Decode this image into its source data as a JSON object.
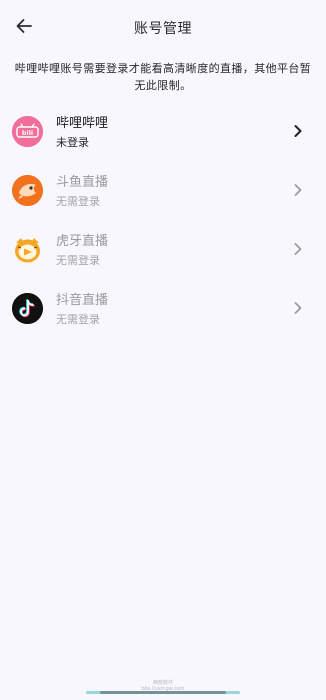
{
  "app_bar": {
    "title": "账号管理",
    "back_icon": "arrow-left-icon"
  },
  "notice": {
    "text": "哔哩哔哩账号需要登录才能看高清晰度的直播，其他平台暂无此限制。"
  },
  "accounts": [
    {
      "name": "哔哩哔哩",
      "status": "未登录",
      "icon": "bilibili-logo-icon",
      "enabled": true,
      "brand_color": "#f06e99"
    },
    {
      "name": "斗鱼直播",
      "status": "无需登录",
      "icon": "douyu-logo-icon",
      "enabled": false,
      "brand_color": "#f2711c"
    },
    {
      "name": "虎牙直播",
      "status": "无需登录",
      "icon": "huya-logo-icon",
      "enabled": false,
      "brand_color": "#f5a623"
    },
    {
      "name": "抖音直播",
      "status": "无需登录",
      "icon": "douyin-logo-icon",
      "enabled": false,
      "brand_color": "#111111"
    }
  ],
  "colors": {
    "background": "#f7f7fd",
    "text_primary": "#1c1c22",
    "text_disabled": "#9a9aa2",
    "home_indicator": "#9bd6dc"
  },
  "watermark": {
    "line1": "西部软件",
    "line2": "bbs.liuxingw.com"
  }
}
